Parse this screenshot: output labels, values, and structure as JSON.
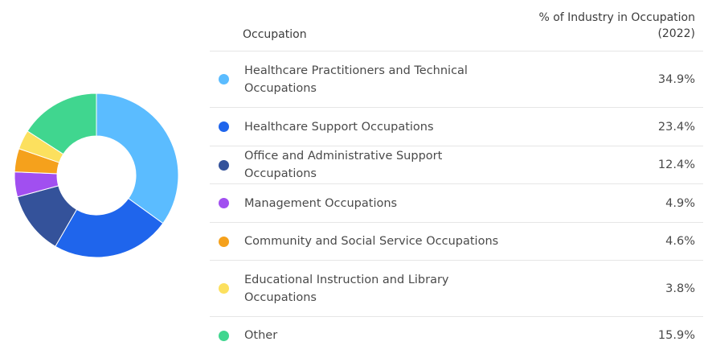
{
  "chart_data": {
    "type": "pie",
    "style": "donut",
    "header": {
      "occupation": "Occupation",
      "percent": "% of Industry in Occupation (2022)"
    },
    "slices": [
      {
        "label": "Healthcare Practitioners and Technical Occupations",
        "value": 34.9,
        "display": "34.9%",
        "color": "#5bbcff"
      },
      {
        "label": "Healthcare Support Occupations",
        "value": 23.4,
        "display": "23.4%",
        "color": "#1f65ec"
      },
      {
        "label": "Office and Administrative Support Occupations",
        "value": 12.4,
        "display": "12.4%",
        "color": "#34529a"
      },
      {
        "label": "Management Occupations",
        "value": 4.9,
        "display": "4.9%",
        "color": "#a14ff0"
      },
      {
        "label": "Community and Social Service Occupations",
        "value": 4.6,
        "display": "4.6%",
        "color": "#f5a11c"
      },
      {
        "label": "Educational Instruction and Library Occupations",
        "value": 3.8,
        "display": "3.8%",
        "color": "#fce05e"
      },
      {
        "label": "Other",
        "value": 15.9,
        "display": "15.9%",
        "color": "#40d68f"
      }
    ]
  }
}
